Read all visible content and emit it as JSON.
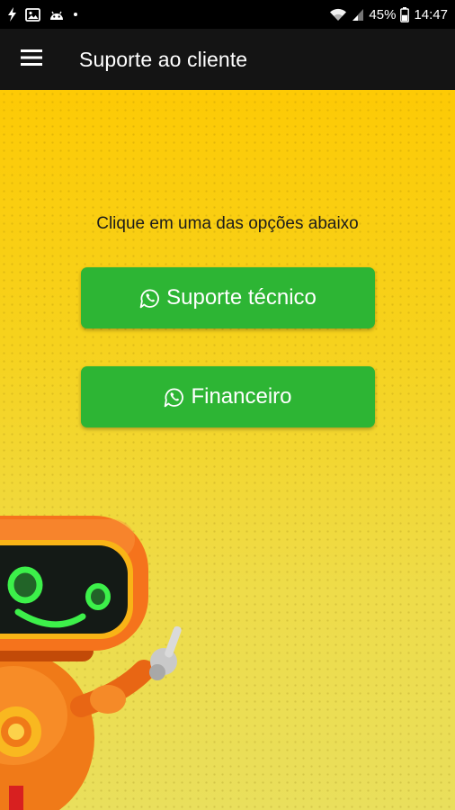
{
  "status_bar": {
    "battery": "45%",
    "time": "14:47",
    "icons": [
      "flash-icon",
      "image-icon",
      "android-icon",
      "dot-icon",
      "wifi-icon",
      "signal-icon",
      "battery-icon"
    ]
  },
  "app_bar": {
    "title": "Suporte ao cliente",
    "menu_icon": "hamburger-menu-icon"
  },
  "main": {
    "instruction": "Clique em uma das opções abaixo",
    "buttons": [
      {
        "label": "Suporte técnico",
        "icon": "whatsapp-icon"
      },
      {
        "label": "Financeiro",
        "icon": "whatsapp-icon"
      }
    ]
  },
  "colors": {
    "status_bar": "#000000",
    "app_bar": "#141414",
    "background_top": "#fdca05",
    "background_bottom": "#e9df5c",
    "button": "#2db534",
    "button_text": "#ffffff",
    "robot_body": "#f5731c",
    "robot_eyes": "#3df04a"
  }
}
